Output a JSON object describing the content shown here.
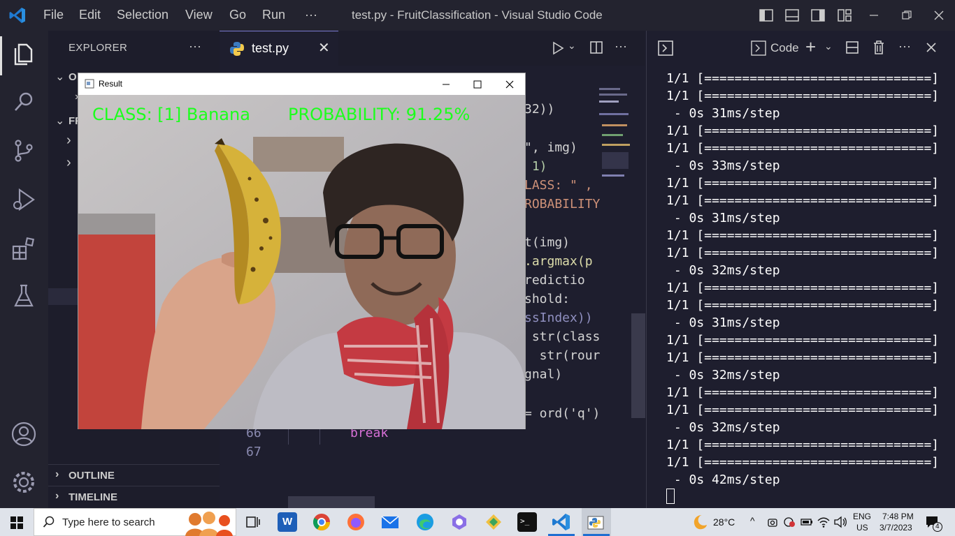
{
  "titlebar": {
    "menus": [
      "File",
      "Edit",
      "Selection",
      "View",
      "Go",
      "Run",
      "···"
    ],
    "title": "test.py - FruitClassification - Visual Studio Code"
  },
  "sidebar": {
    "header": "EXPLORER",
    "more": "···",
    "section1": "O",
    "section2": "FR",
    "outline": "OUTLINE",
    "timeline": "TIMELINE"
  },
  "editor": {
    "tab_label": "test.py",
    "code_fragments": [
      {
        "text": "32))",
        "color": "#d4d4d4"
      },
      {
        "text": "\", img)",
        "color": "#d4d4d4"
      },
      {
        "text": " 1)",
        "color": "#b5cea8"
      },
      {
        "text": "LASS: \" ,",
        "color": "#ce9178"
      },
      {
        "text": "ROBABILITY",
        "color": "#ce9178"
      },
      {
        "text": "t(img)",
        "color": "#d4d4d4"
      },
      {
        "text": ".argmax(p",
        "color": "#dcdcaa"
      },
      {
        "text": "redictio",
        "color": "#d4d4d4"
      },
      {
        "text": "shold:",
        "color": "#d4d4d4"
      },
      {
        "text": "ssIndex))",
        "color": "#9090c0"
      },
      {
        "text": " str(class",
        "color": "#d4d4d4"
      },
      {
        "text": "  str(rour",
        "color": "#d4d4d4"
      },
      {
        "text": "gnal)",
        "color": "#d4d4d4"
      },
      {
        "text": "= ord('q')",
        "color": "#d4d4d4"
      }
    ],
    "line_66": "66",
    "line_67": "67",
    "break_kw": "break"
  },
  "terminal": {
    "tab_label": "Code",
    "lines": [
      "1/1 [==============================]",
      "1/1 [==============================]",
      " - 0s 31ms/step",
      "1/1 [==============================]",
      "1/1 [==============================]",
      " - 0s 33ms/step",
      "1/1 [==============================]",
      "1/1 [==============================]",
      " - 0s 31ms/step",
      "1/1 [==============================]",
      "1/1 [==============================]",
      " - 0s 32ms/step",
      "1/1 [==============================]",
      "1/1 [==============================]",
      " - 0s 31ms/step",
      "1/1 [==============================]",
      "1/1 [==============================]",
      " - 0s 32ms/step",
      "1/1 [==============================]",
      "1/1 [==============================]",
      " - 0s 32ms/step",
      "1/1 [==============================]",
      "1/1 [==============================]",
      " - 0s 42ms/step"
    ]
  },
  "result_window": {
    "title": "Result",
    "class_text": "CLASS:  [1] Banana",
    "prob_text": "PROBABILITY: 91.25%"
  },
  "taskbar": {
    "search_placeholder": "Type here to search",
    "weather": "28°C",
    "lang1": "ENG",
    "lang2": "US",
    "time": "7:48 PM",
    "date": "3/7/2023",
    "notif_count": "4"
  }
}
